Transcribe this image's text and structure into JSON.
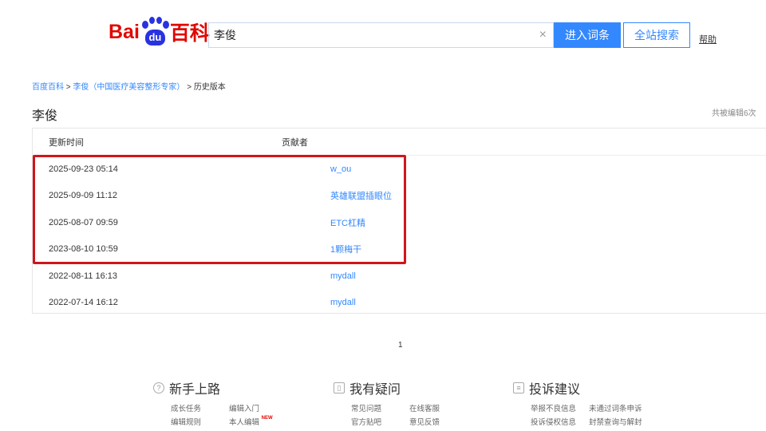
{
  "header": {
    "logo_text_left": "Bai",
    "logo_text_paw": "du",
    "logo_text_right": "百科",
    "search_value": "李俊",
    "clear_icon": "×",
    "enter_button": "进入词条",
    "site_search_button": "全站搜索",
    "help_link": "帮助"
  },
  "breadcrumb": {
    "items": [
      "百度百科",
      "李俊（中国医疗美容整形专家）",
      "历史版本"
    ],
    "sep": ">"
  },
  "page": {
    "title": "李俊",
    "edit_count": "共被编辑6次"
  },
  "table": {
    "headers": [
      "更新时间",
      "贡献者"
    ],
    "rows": [
      {
        "time": "2025-09-23 05:14",
        "contributor": "w_ou"
      },
      {
        "time": "2025-09-09 11:12",
        "contributor": "英雄联盟插眼位"
      },
      {
        "time": "2025-08-07 09:59",
        "contributor": "ETC杠精"
      },
      {
        "time": "2023-08-10 10:59",
        "contributor": "1颗梅干"
      },
      {
        "time": "2022-08-11 16:13",
        "contributor": "mydall"
      },
      {
        "time": "2022-07-14 16:12",
        "contributor": "mydall"
      }
    ]
  },
  "pagination": {
    "current": "1"
  },
  "footer": [
    {
      "icon": "?",
      "title": "新手上路",
      "links": [
        "成长任务",
        "编辑入门",
        "编辑规则",
        "本人编辑"
      ],
      "badge": "NEW"
    },
    {
      "icon": "▯",
      "title": "我有疑问",
      "links": [
        "常见问题",
        "在线客服",
        "官方贴吧",
        "意见反馈"
      ]
    },
    {
      "icon": "≡",
      "title": "投诉建议",
      "links": [
        "举报不良信息",
        "未通过词条申诉",
        "投诉侵权信息",
        "封禁查询与解封"
      ]
    }
  ],
  "colors": {
    "accent": "#3388ff",
    "highlight": "#d0161b",
    "logo_red": "#e10601",
    "logo_blue": "#2932e1"
  }
}
